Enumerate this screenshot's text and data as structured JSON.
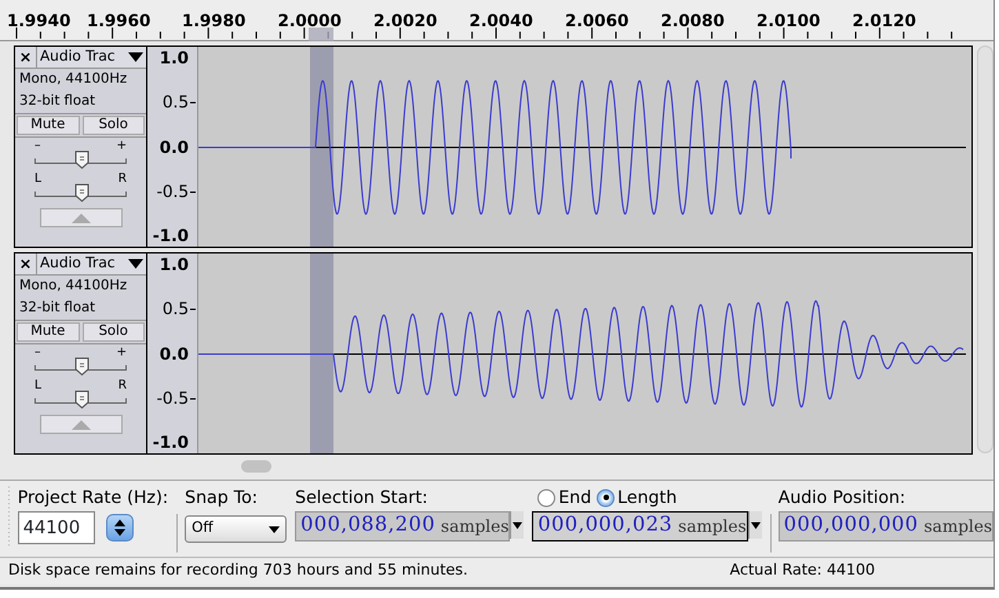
{
  "ruler": {
    "labels": [
      "1.9940",
      "1.9960",
      "1.9980",
      "2.0000",
      "2.0020",
      "2.0040",
      "2.0060",
      "2.0080",
      "2.0100",
      "2.0120"
    ]
  },
  "tracks": [
    {
      "close": "×",
      "name": "Audio Trac",
      "info": [
        "Mono, 44100Hz",
        "32-bit float"
      ],
      "mute": "Mute",
      "solo": "Solo",
      "gain_marks": [
        "–",
        "+"
      ],
      "gain": {
        "level": 0.5
      },
      "pan_marks": [
        "L",
        "R"
      ],
      "pan": {
        "level": 0.5
      },
      "scale": [
        "1.0",
        "0.5",
        "0.0",
        "-0.5",
        "-1.0"
      ],
      "kind": "sine"
    },
    {
      "close": "×",
      "name": "Audio Trac",
      "info": [
        "Mono, 44100Hz",
        "32-bit float"
      ],
      "mute": "Mute",
      "solo": "Solo",
      "gain_marks": [
        "–",
        "+"
      ],
      "gain": {
        "level": 0.5
      },
      "pan_marks": [
        "L",
        "R"
      ],
      "pan": {
        "level": 0.5
      },
      "scale": [
        "1.0",
        "0.5",
        "0.0",
        "-0.5",
        "-1.0"
      ],
      "kind": "decay"
    }
  ],
  "selection_bar": {
    "project_rate_label": "Project Rate (Hz):",
    "project_rate": "44100",
    "snap_label": "Snap To:",
    "snap_value": "Off",
    "start_label": "Selection Start:",
    "start_value": "000,088,200",
    "start_unit": "samples",
    "radios": [
      {
        "label": "End",
        "selected": false
      },
      {
        "label": "Length",
        "selected": true
      }
    ],
    "length_value": "000,000,023",
    "length_unit": "samples",
    "position_label": "Audio Position:",
    "position_value": "000,000,000",
    "position_unit": "samples"
  },
  "status_bar": {
    "left": "Disk space remains for recording 703 hours and 55 minutes.",
    "right": "Actual Rate: 44100"
  }
}
